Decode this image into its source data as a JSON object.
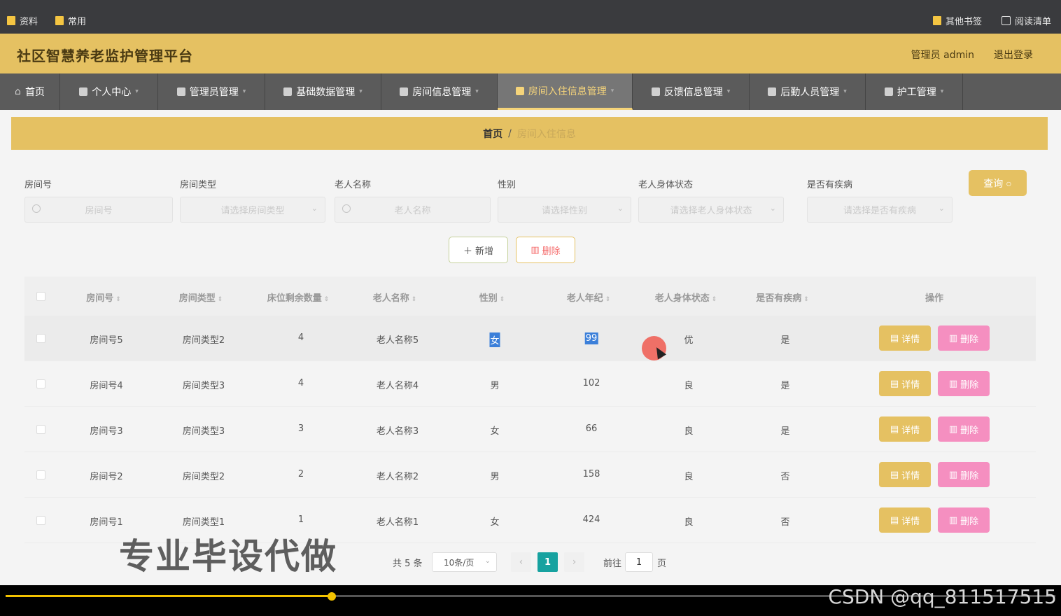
{
  "browser": {
    "bookmarks": [
      "资料",
      "常用"
    ],
    "bookmarks_right": [
      "其他书签",
      "阅读清单"
    ]
  },
  "header": {
    "title": "社区智慧养老监护管理平台",
    "user_label": "管理员 admin",
    "logout_label": "退出登录"
  },
  "nav": {
    "items": [
      {
        "label": "首页",
        "caret": false
      },
      {
        "label": "个人中心",
        "caret": true
      },
      {
        "label": "管理员管理",
        "caret": true
      },
      {
        "label": "基础数据管理",
        "caret": true
      },
      {
        "label": "房间信息管理",
        "caret": true
      },
      {
        "label": "房间入住信息管理",
        "caret": true,
        "active": true
      },
      {
        "label": "反馈信息管理",
        "caret": true
      },
      {
        "label": "后勤人员管理",
        "caret": true
      },
      {
        "label": "护工管理",
        "caret": true
      }
    ]
  },
  "breadcrumb": {
    "home": "首页",
    "separator": "/",
    "current": "房间入住信息"
  },
  "filters": {
    "room_no": {
      "label": "房间号",
      "placeholder": "房间号"
    },
    "room_type": {
      "label": "房间类型",
      "placeholder": "请选择房间类型"
    },
    "elder_name": {
      "label": "老人名称",
      "placeholder": "老人名称"
    },
    "gender": {
      "label": "性别",
      "placeholder": "请选择性别"
    },
    "health": {
      "label": "老人身体状态",
      "placeholder": "请选择老人身体状态"
    },
    "disease": {
      "label": "是否有疾病",
      "placeholder": "请选择是否有疾病"
    },
    "query_label": "查询"
  },
  "actions": {
    "add_label": "新增",
    "delete_label": "删除"
  },
  "table": {
    "headers": [
      "房间号",
      "房间类型",
      "床位剩余数量",
      "老人名称",
      "性别",
      "老人年纪",
      "老人身体状态",
      "是否有疾病",
      "操作"
    ],
    "rows": [
      {
        "room": "房间号5",
        "type": "房间类型2",
        "beds": "4",
        "name": "老人名称5",
        "gender": "女",
        "age": "99",
        "health": "优",
        "disease": "是"
      },
      {
        "room": "房间号4",
        "type": "房间类型3",
        "beds": "4",
        "name": "老人名称4",
        "gender": "男",
        "age": "102",
        "health": "良",
        "disease": "是"
      },
      {
        "room": "房间号3",
        "type": "房间类型3",
        "beds": "3",
        "name": "老人名称3",
        "gender": "女",
        "age": "66",
        "health": "良",
        "disease": "是"
      },
      {
        "room": "房间号2",
        "type": "房间类型2",
        "beds": "2",
        "name": "老人名称2",
        "gender": "男",
        "age": "158",
        "health": "良",
        "disease": "否"
      },
      {
        "room": "房间号1",
        "type": "房间类型1",
        "beds": "1",
        "name": "老人名称1",
        "gender": "女",
        "age": "424",
        "health": "良",
        "disease": "否"
      }
    ],
    "detail_label": "详情",
    "delete_label": "删除"
  },
  "pagination": {
    "total": "共 5 条",
    "page_size": "10条/页",
    "current_page": "1",
    "goto_label": "前往",
    "goto_value": "1",
    "page_suffix": "页"
  },
  "overlay_text": "专业毕设代做",
  "watermark": "CSDN @qq_811517515",
  "colors": {
    "accent": "#e5c162",
    "nav_bg": "#5b5b5b",
    "delete_pink": "#f58fc0",
    "page_active": "#17a2a0"
  }
}
